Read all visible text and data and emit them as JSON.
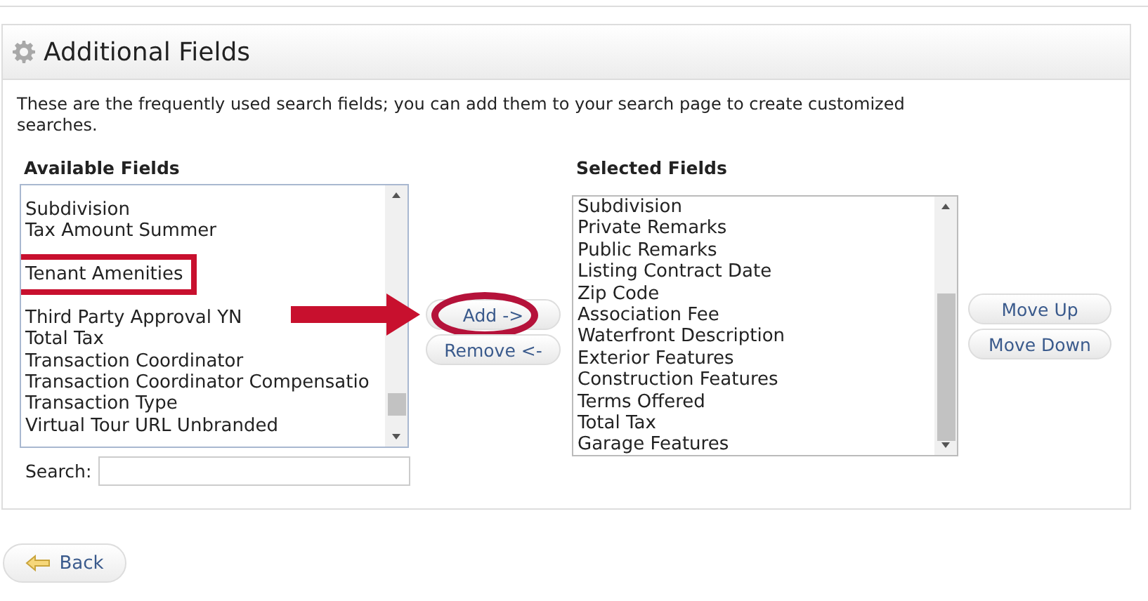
{
  "panel": {
    "title": "Additional Fields",
    "description": "These are the frequently used search fields; you can add them to your search page to create customized searches."
  },
  "available": {
    "label": "Available Fields",
    "items": [
      {
        "text": "Subdivision",
        "selected": false,
        "highlighted": false
      },
      {
        "text": "Tax Amount Summer",
        "selected": false,
        "highlighted": false
      },
      {
        "text": "Tenant Amenities",
        "selected": false,
        "highlighted": true
      },
      {
        "text": "Third Party Approval YN",
        "selected": false,
        "highlighted": false
      },
      {
        "text": "Total Tax",
        "selected": false,
        "highlighted": false
      },
      {
        "text": "Transaction Coordinator",
        "selected": false,
        "highlighted": false
      },
      {
        "text": "Transaction Coordinator Compensatio",
        "selected": false,
        "highlighted": false
      },
      {
        "text": "Transaction Type",
        "selected": false,
        "highlighted": false
      },
      {
        "text": "Virtual Tour URL Unbranded",
        "selected": false,
        "highlighted": false
      }
    ],
    "search_label": "Search:"
  },
  "transfer_buttons": [
    {
      "label": "Add ->",
      "highlighted": true
    },
    {
      "label": "Remove <-",
      "highlighted": false
    }
  ],
  "selected": {
    "label": "Selected Fields",
    "items": [
      {
        "text": "Subdivision",
        "selected": false
      },
      {
        "text": "Private Remarks",
        "selected": false
      },
      {
        "text": "Public Remarks",
        "selected": false
      },
      {
        "text": "Listing Contract Date",
        "selected": false
      },
      {
        "text": "Zip Code",
        "selected": false
      },
      {
        "text": "Association Fee",
        "selected": false
      },
      {
        "text": "Waterfront Description",
        "selected": false
      },
      {
        "text": "Exterior Features",
        "selected": false
      },
      {
        "text": "Construction Features",
        "selected": false
      },
      {
        "text": "Terms Offered",
        "selected": false
      },
      {
        "text": "Total Tax",
        "selected": false
      },
      {
        "text": "Garage Features",
        "selected": false
      }
    ]
  },
  "order_buttons": [
    "Move Up",
    "Move Down"
  ],
  "back_button": "Back"
}
